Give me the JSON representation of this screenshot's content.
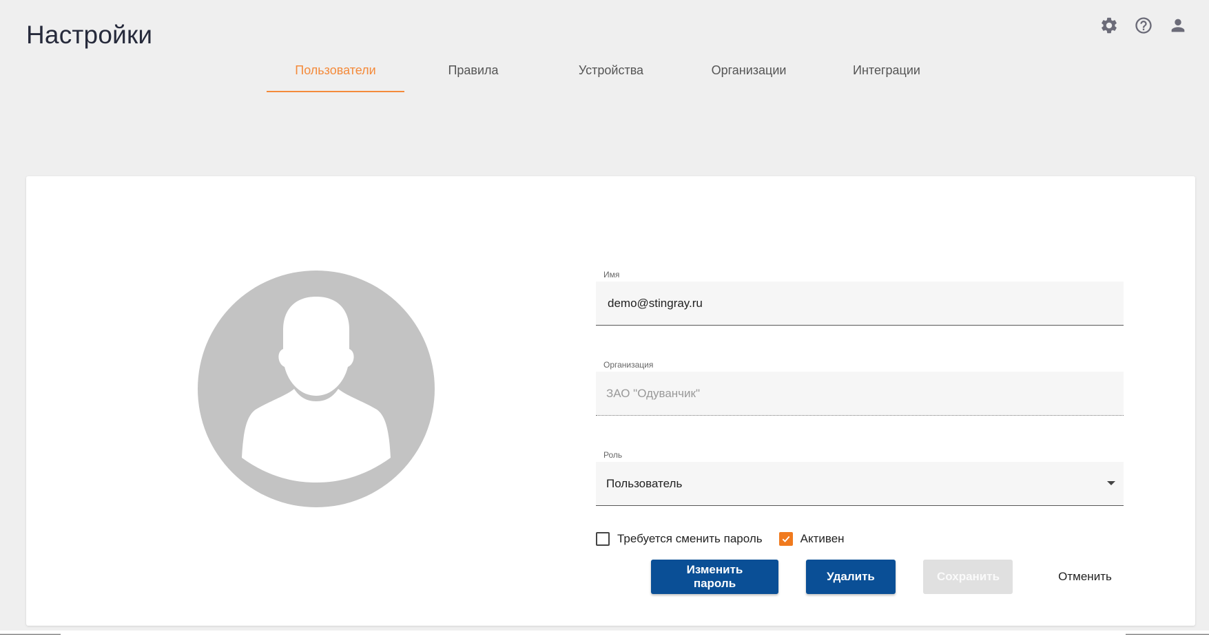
{
  "header": {
    "title": "Настройки"
  },
  "top_icons": [
    "gear-icon",
    "help-icon",
    "account-icon"
  ],
  "tabs": [
    {
      "label": "Пользователи",
      "active": true
    },
    {
      "label": "Правила",
      "active": false
    },
    {
      "label": "Устройства",
      "active": false
    },
    {
      "label": "Организации",
      "active": false
    },
    {
      "label": "Интеграции",
      "active": false
    }
  ],
  "form": {
    "name": {
      "label": "Имя",
      "value": "demo@stingray.ru"
    },
    "organization": {
      "label": "Организация",
      "value": "ЗАО \"Одуванчик\""
    },
    "role": {
      "label": "Роль",
      "value": "Пользователь"
    },
    "require_password_change": {
      "label": "Требуется сменить пароль",
      "checked": false
    },
    "active": {
      "label": "Активен",
      "checked": true
    }
  },
  "buttons": {
    "change_password": "Изменить пароль",
    "delete": "Удалить",
    "save": "Сохранить",
    "cancel": "Отменить"
  },
  "colors": {
    "accent": "#f48a3a",
    "primary_button": "#0a4f96",
    "avatar_bg": "#c3c3c3"
  }
}
